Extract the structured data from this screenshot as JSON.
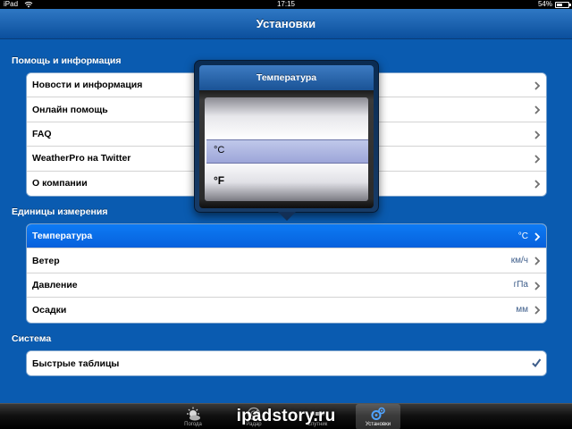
{
  "status_bar": {
    "device": "iPad",
    "time": "17:15",
    "battery": "54%",
    "battery_level": 0.54
  },
  "nav": {
    "title": "Установки"
  },
  "sections": {
    "help": {
      "title": "Помощь и информация",
      "items": [
        {
          "label": "Новости и информация"
        },
        {
          "label": "Онлайн помощь"
        },
        {
          "label": "FAQ"
        },
        {
          "label": "WeatherPro на Twitter"
        },
        {
          "label": "О компании"
        }
      ]
    },
    "units": {
      "title": "Единицы измерения",
      "items": [
        {
          "label": "Температура",
          "value": "°C"
        },
        {
          "label": "Ветер",
          "value": "км/ч"
        },
        {
          "label": "Давление",
          "value": "гПа"
        },
        {
          "label": "Осадки",
          "value": "мм"
        }
      ]
    },
    "system": {
      "title": "Система",
      "items": [
        {
          "label": "Быстрые таблицы"
        }
      ]
    }
  },
  "popover": {
    "title": "Температура",
    "options": [
      "°C",
      "°F"
    ],
    "selected": "°C"
  },
  "tabbar": {
    "tabs": [
      {
        "label": "Погода",
        "icon": "weather-icon"
      },
      {
        "label": "Радар",
        "icon": "radar-icon"
      },
      {
        "label": "Спутник",
        "icon": "satellite-icon"
      },
      {
        "label": "Установки",
        "icon": "settings-icon"
      }
    ],
    "active_index": 3
  },
  "watermark": "ipadstory.ru",
  "colors": {
    "background": "#0a5bb0",
    "selected_row": "#0d7bf4",
    "value_text": "#3d5d8a"
  }
}
